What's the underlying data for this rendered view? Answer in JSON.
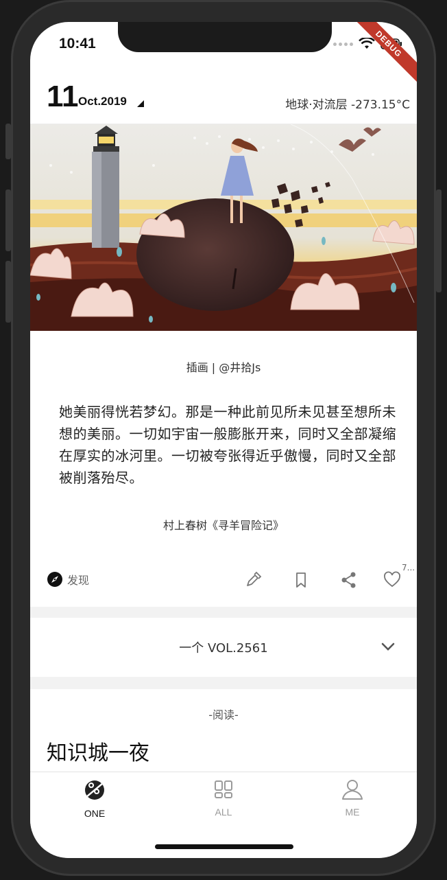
{
  "status": {
    "time": "10:41",
    "debug": "DEBUG"
  },
  "header": {
    "day": "11",
    "month": "Oct.2019",
    "weather": "地球·对流层 -273.15°C"
  },
  "card": {
    "credit": "插画 | @井拾Js",
    "quote": "她美丽得恍若梦幻。那是一种此前见所未见甚至想所未想的美丽。一切如宇宙一般膨胀开来，同时又全部凝缩在厚实的冰河里。一切被夸张得近乎傲慢，同时又全部被削落殆尽。",
    "source": "村上春树《寻羊冒险记》",
    "discover": "发现",
    "like_count": "7..."
  },
  "vol": {
    "label": "一个 VOL.2561"
  },
  "reading": {
    "tag": "-阅读-",
    "title": "知识城一夜"
  },
  "tabs": [
    {
      "label": "ONE",
      "icon": "one-icon",
      "active": true
    },
    {
      "label": "ALL",
      "icon": "grid-icon",
      "active": false
    },
    {
      "label": "ME",
      "icon": "person-icon",
      "active": false
    }
  ],
  "colors": {
    "active": "#111111",
    "inactive": "#9a9a9a",
    "debug": "#c0392b"
  }
}
